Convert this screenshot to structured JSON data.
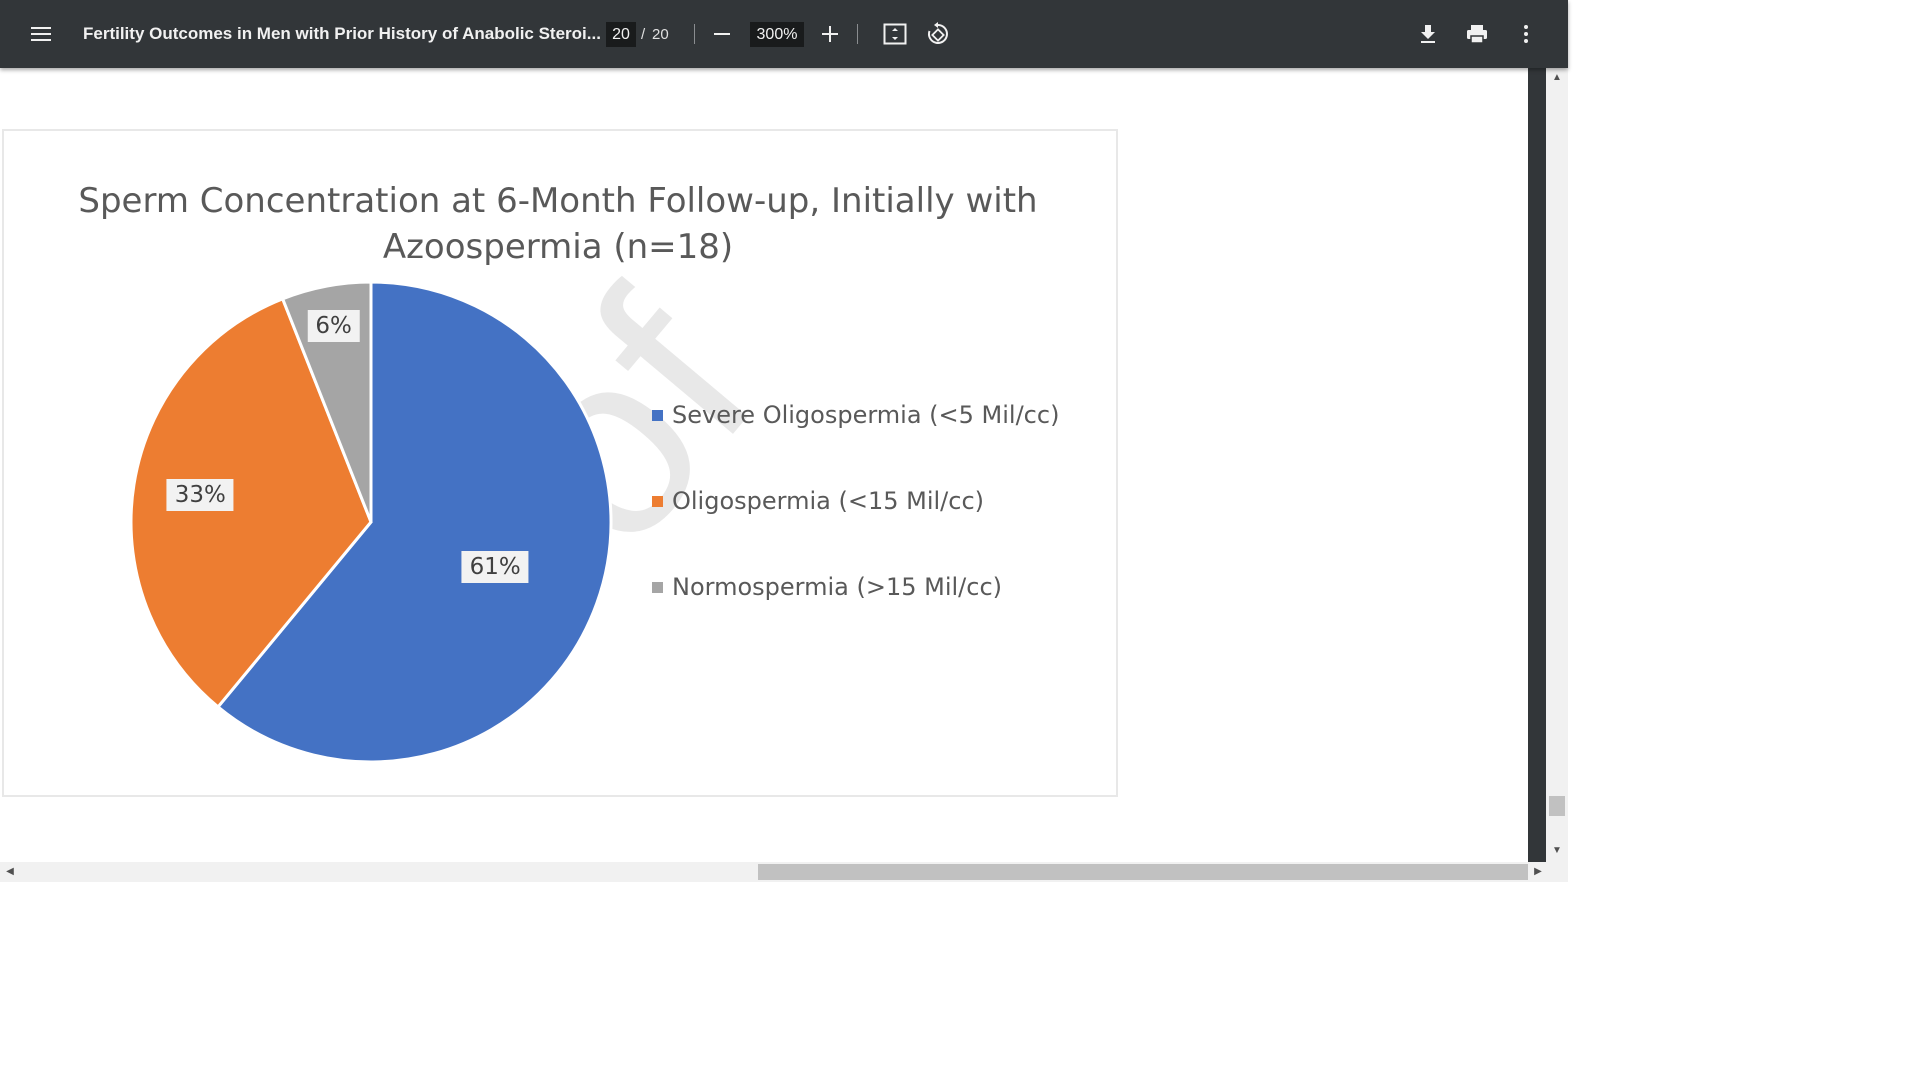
{
  "toolbar": {
    "menu_icon": "hamburger-menu-icon",
    "title": "Fertility Outcomes in Men with Prior History of Anabolic Steroi...",
    "page_current": "20",
    "page_separator": "/",
    "page_total": "20",
    "zoom_out_icon": "minus-icon",
    "zoom_value": "300%",
    "zoom_in_icon": "plus-icon",
    "fit_page_icon": "fit-to-page-icon",
    "rotate_icon": "rotate-icon",
    "download_icon": "download-icon",
    "print_icon": "print-icon",
    "more_icon": "more-vertical-icon"
  },
  "watermark": "oof",
  "chart_data": {
    "type": "pie",
    "title": "Sperm Concentration at 6-Month Follow-up, Initially with Azoospermia (n=18)",
    "title_lines": [
      "Sperm Concentration at 6-Month Follow-up, Initially with",
      "Azoospermia (n=18)"
    ],
    "categories": [
      "Severe Oligospermia (<5 Mil/cc)",
      "Oligospermia (<15 Mil/cc)",
      "Normospermia (>15 Mil/cc)"
    ],
    "values": [
      61,
      33,
      6
    ],
    "labels": [
      "61%",
      "33%",
      "6%"
    ],
    "colors": [
      "#4472C4",
      "#ED7D31",
      "#A5A5A5"
    ],
    "legend_position": "right"
  }
}
